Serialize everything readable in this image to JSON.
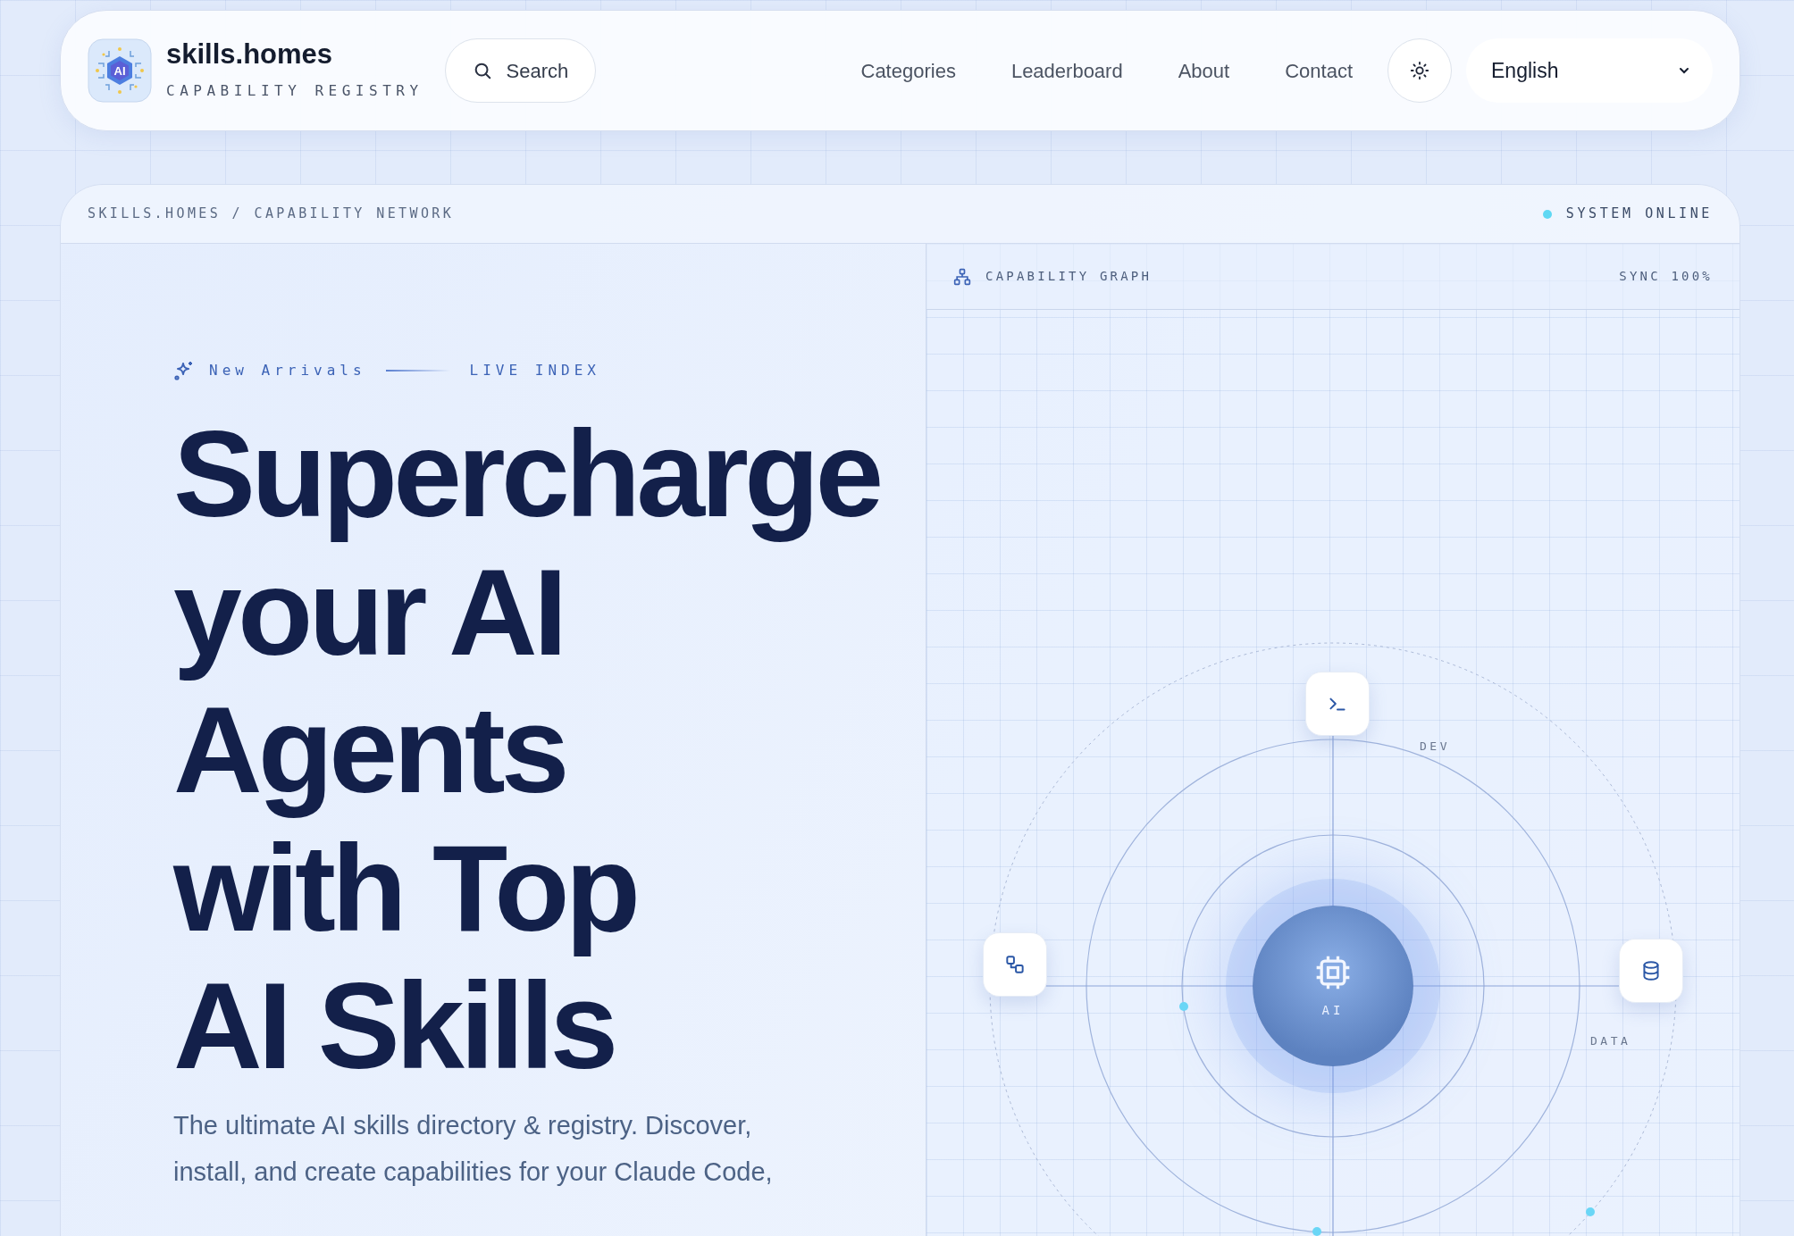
{
  "header": {
    "logo_text": "AI",
    "brand": "skills.homes",
    "tagline": "CAPABILITY REGISTRY",
    "search": {
      "label": "Search"
    },
    "nav": [
      {
        "label": "Categories"
      },
      {
        "label": "Leaderboard"
      },
      {
        "label": "About"
      },
      {
        "label": "Contact"
      }
    ],
    "language": {
      "value": "English"
    }
  },
  "hero": {
    "breadcrumb": "SKILLS.HOMES / CAPABILITY NETWORK",
    "status": "SYSTEM ONLINE",
    "eyebrow": "New Arrivals",
    "eyebrow_tag": "LIVE INDEX",
    "headline": [
      "Supercharge",
      "your AI",
      "Agents",
      "with Top",
      "AI Skills"
    ],
    "description": "The ultimate AI skills directory & registry. Discover, install, and create capabilities for your Claude Code,"
  },
  "graph": {
    "title": "CAPABILITY GRAPH",
    "sync": "SYNC 100%",
    "center_label": "AI",
    "nodes": [
      {
        "kind": "terminal",
        "label": "DEV"
      },
      {
        "kind": "workflow"
      },
      {
        "kind": "database",
        "label": "DATA"
      }
    ]
  }
}
